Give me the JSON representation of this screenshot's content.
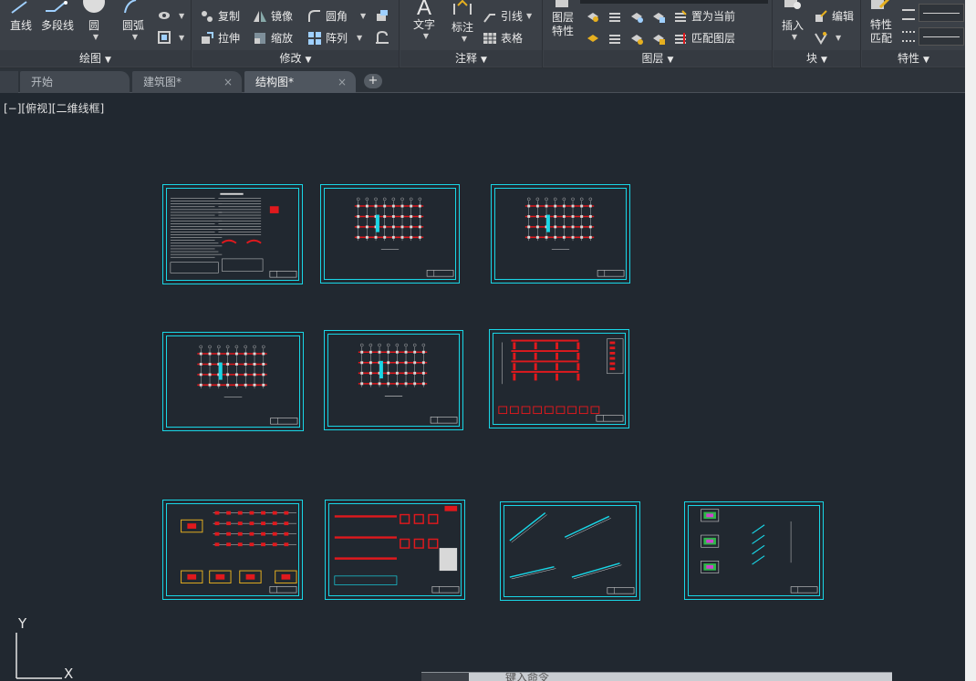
{
  "ribbon": {
    "draw": {
      "title": "绘图",
      "line": "直线",
      "polyline": "多段线",
      "circle": "圆",
      "arc": "圆弧"
    },
    "modify": {
      "title": "修改",
      "move": "",
      "copy": "复制",
      "mirror": "镜像",
      "fillet": "圆角",
      "stretch": "拉伸",
      "scale": "缩放",
      "array": "阵列"
    },
    "annotation": {
      "title": "注释",
      "text": "文字",
      "dimension": "标注",
      "leader": "引线",
      "table": "表格"
    },
    "layers": {
      "title": "图层",
      "properties_line1": "图层",
      "properties_line2": "特性",
      "set_current": "置为当前",
      "match_layer": "匹配图层"
    },
    "block": {
      "title": "块",
      "insert": "插入",
      "edit": "编辑"
    },
    "properties": {
      "title": "特性",
      "match_line1": "特性",
      "match_line2": "匹配"
    }
  },
  "tabs": [
    {
      "label": "开始",
      "active": false
    },
    {
      "label": "建筑图*",
      "active": false
    },
    {
      "label": "结构图*",
      "active": true
    }
  ],
  "tab_close": "×",
  "tab_add": "+",
  "viewport": {
    "label": "[−][俯视][二维线框]"
  },
  "ucs": {
    "x_label": "X",
    "y_label": "Y"
  },
  "command_line": {
    "text": "键入命令"
  },
  "colors": {
    "canvas": "#212830",
    "sheet_border": "#19d6e6",
    "drawing_red": "#e0191d",
    "drawing_white": "#d8d8d8",
    "ribbon": "#3b4047"
  },
  "sheets": [
    {
      "type": "notes"
    },
    {
      "type": "plan"
    },
    {
      "type": "plan"
    },
    {
      "type": "plan"
    },
    {
      "type": "plan"
    },
    {
      "type": "frames"
    },
    {
      "type": "foundation"
    },
    {
      "type": "details"
    },
    {
      "type": "stairs"
    },
    {
      "type": "sections"
    }
  ]
}
